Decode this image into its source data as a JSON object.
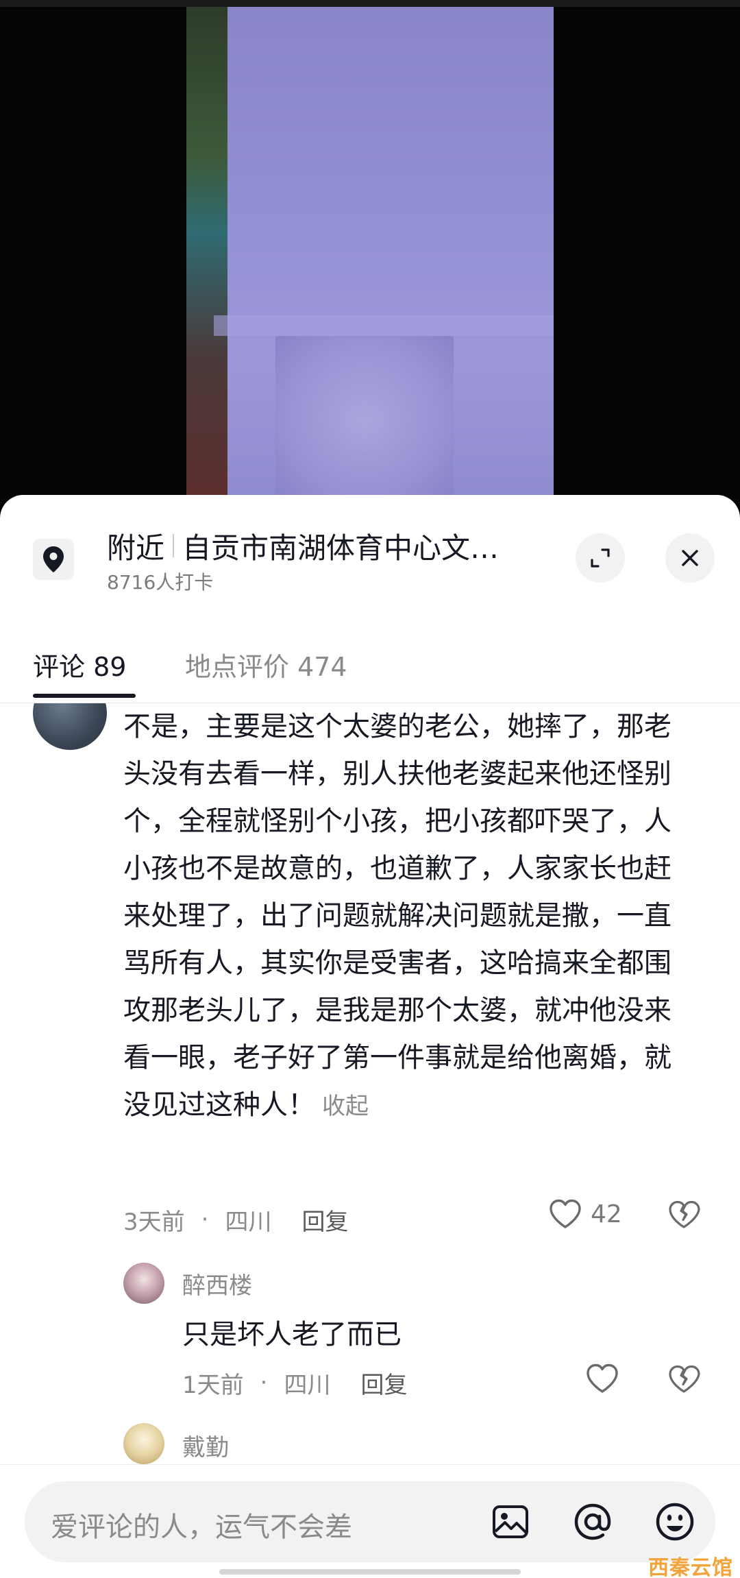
{
  "location": {
    "prefix": "附近",
    "name": "自贡市南湖体育中心文…",
    "checkins": "8716人打卡"
  },
  "tabs": {
    "comments": "评论 89",
    "reviews": "地点评价 474"
  },
  "comment": {
    "text": "不是，主要是这个太婆的老公，她摔了，那老头没有去看一样，别人扶他老婆起来他还怪别个，全程就怪别个小孩，把小孩都吓哭了，人小孩也不是故意的，也道歉了，人家家长也赶来处理了，出了问题就解决问题就是撒，一直骂所有人，其实你是受害者，这哈搞来全都围攻那老头儿了，是我是那个太婆，就冲他没来看一眼，老子好了第一件事就是给他离婚，就没见过这种人！",
    "collapse": "收起",
    "time": "3天前",
    "dot": "·",
    "region": "四川",
    "reply": "回复",
    "likes": "42"
  },
  "replies": [
    {
      "name": "醉西楼",
      "text": "只是坏人老了而已",
      "time": "1天前",
      "dot": "·",
      "region": "四川",
      "reply": "回复"
    },
    {
      "name": "戴勤"
    }
  ],
  "input": {
    "placeholder": "爱评论的人，运气不会差"
  },
  "watermark": "西秦云馆",
  "icons": {
    "location": "location-pin-icon",
    "expand": "expand-icon",
    "close": "close-icon",
    "like": "heart-icon",
    "dislike": "broken-heart-icon",
    "image": "image-icon",
    "mention": "at-icon",
    "emoji": "emoji-icon"
  },
  "colors": {
    "text": "#161823",
    "muted": "#8a8a8a",
    "sheet": "#ffffff",
    "input": "#f2f2f3",
    "watermark": "#f2a33a"
  }
}
